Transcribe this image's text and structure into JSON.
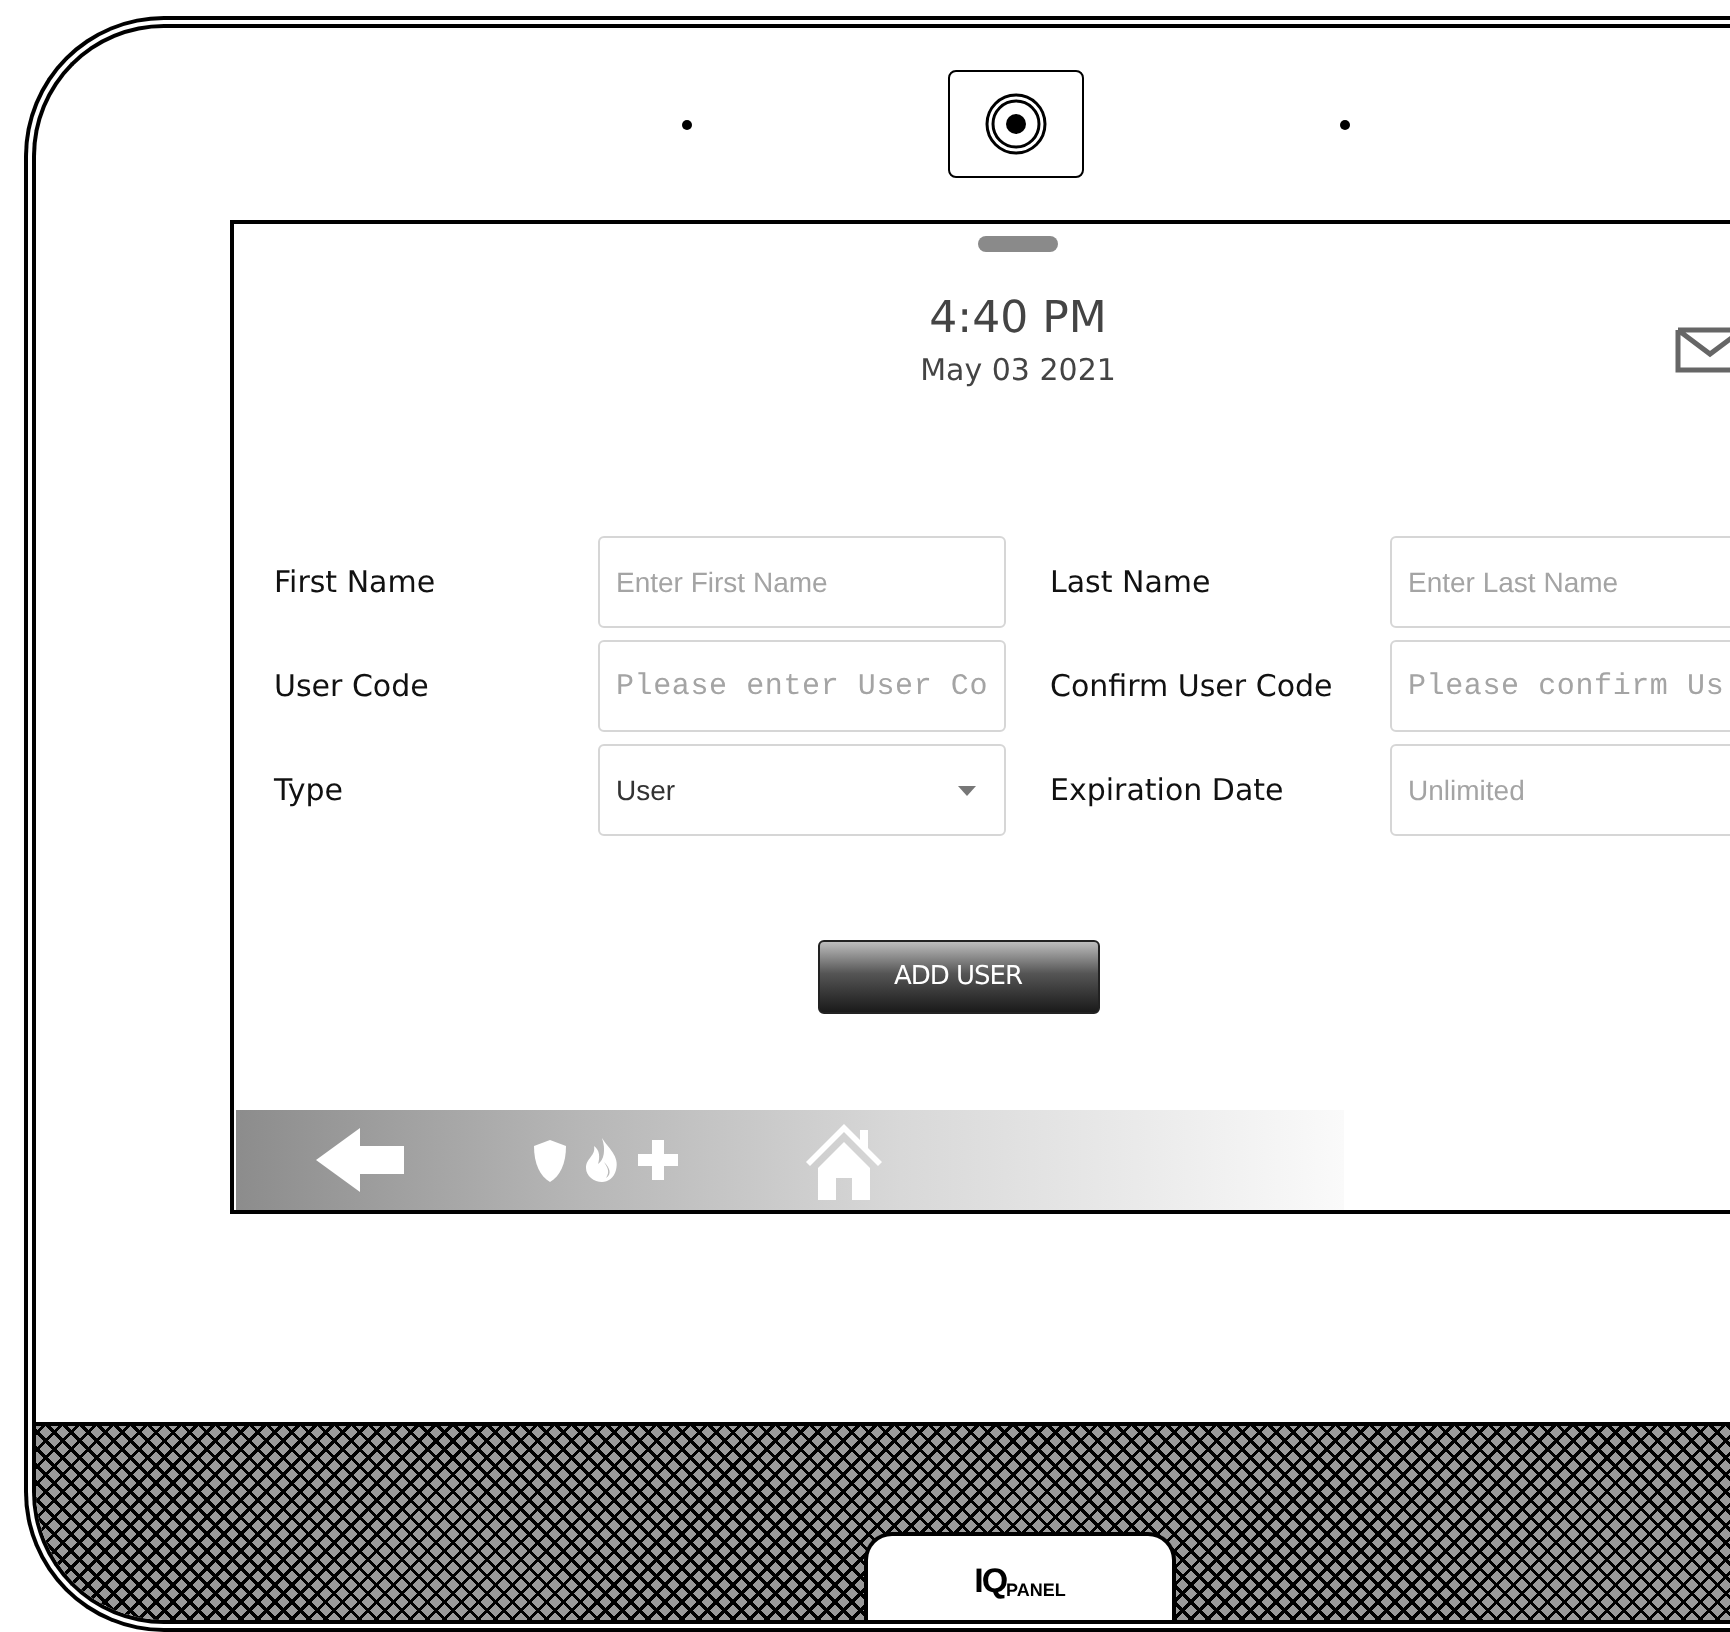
{
  "screen": {
    "clock": {
      "time": "4:40 PM",
      "date": "May 03 2021"
    },
    "form": {
      "fields": [
        {
          "label": "First Name",
          "kind": "text",
          "placeholder": "Enter First Name"
        },
        {
          "label": "Last Name",
          "kind": "text",
          "placeholder": "Enter Last Name"
        },
        {
          "label": "User Code",
          "kind": "code",
          "placeholder": "Please enter User Co"
        },
        {
          "label": "Confirm User Code",
          "kind": "code",
          "placeholder": "Please confirm Us"
        },
        {
          "label": "Type",
          "kind": "select",
          "value": "User"
        },
        {
          "label": "Expiration Date",
          "kind": "text",
          "placeholder": "Unlimited"
        }
      ]
    },
    "add_button": "ADD USER"
  },
  "logo": {
    "brand": "IQ",
    "product": "PANEL"
  }
}
